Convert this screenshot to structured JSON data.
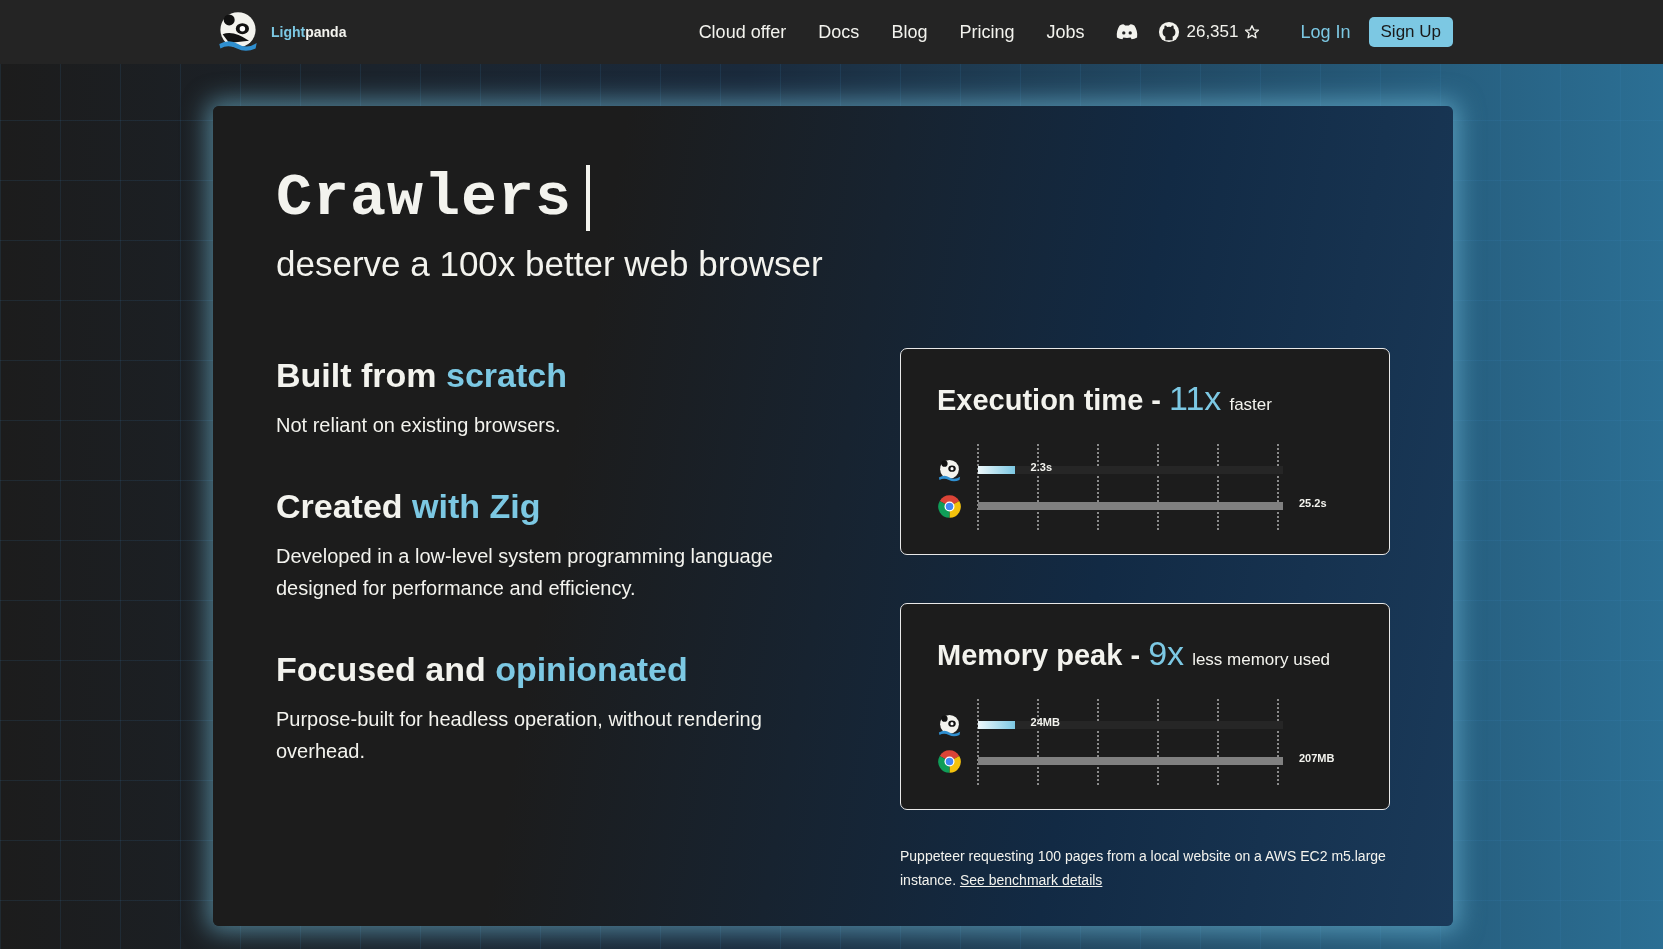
{
  "nav": {
    "brand": {
      "part_1": "Light",
      "part_2": "panda"
    },
    "links": [
      "Cloud offer",
      "Docs",
      "Blog",
      "Pricing",
      "Jobs"
    ],
    "github_stars": "26,351",
    "login": "Log In",
    "signup": "Sign Up"
  },
  "hero": {
    "heading": "Crawlers",
    "subheading": "deserve a 100x better web browser"
  },
  "features": [
    {
      "title": "Built from",
      "accent": "scratch",
      "text": "Not reliant on existing browsers."
    },
    {
      "title": "Created",
      "accent": "with Zig",
      "text": "Developed in a low-level system programming language designed for performance and efficiency."
    },
    {
      "title": "Focused and",
      "accent": "opinionated",
      "text": "Purpose-built for headless operation, without rendering overhead."
    }
  ],
  "benchmarks": [
    {
      "title": "Execution time -",
      "multiplier": "11x",
      "note": "faster",
      "rows": [
        {
          "kind": "panda",
          "level": 0.12,
          "reading": "2.3s"
        },
        {
          "kind": "chrome",
          "level": 1.0,
          "reading": "25.2s"
        }
      ]
    },
    {
      "title": "Memory peak -",
      "multiplier": "9x",
      "note": "less memory used",
      "rows": [
        {
          "kind": "panda",
          "level": 0.12,
          "reading": "24MB"
        },
        {
          "kind": "chrome",
          "level": 1.0,
          "reading": "207MB"
        }
      ]
    }
  ],
  "footnote": {
    "text": "Puppeteer requesting 100 pages from a local website on a AWS EC2 m5.large instance.",
    "link": "See benchmark details"
  }
}
